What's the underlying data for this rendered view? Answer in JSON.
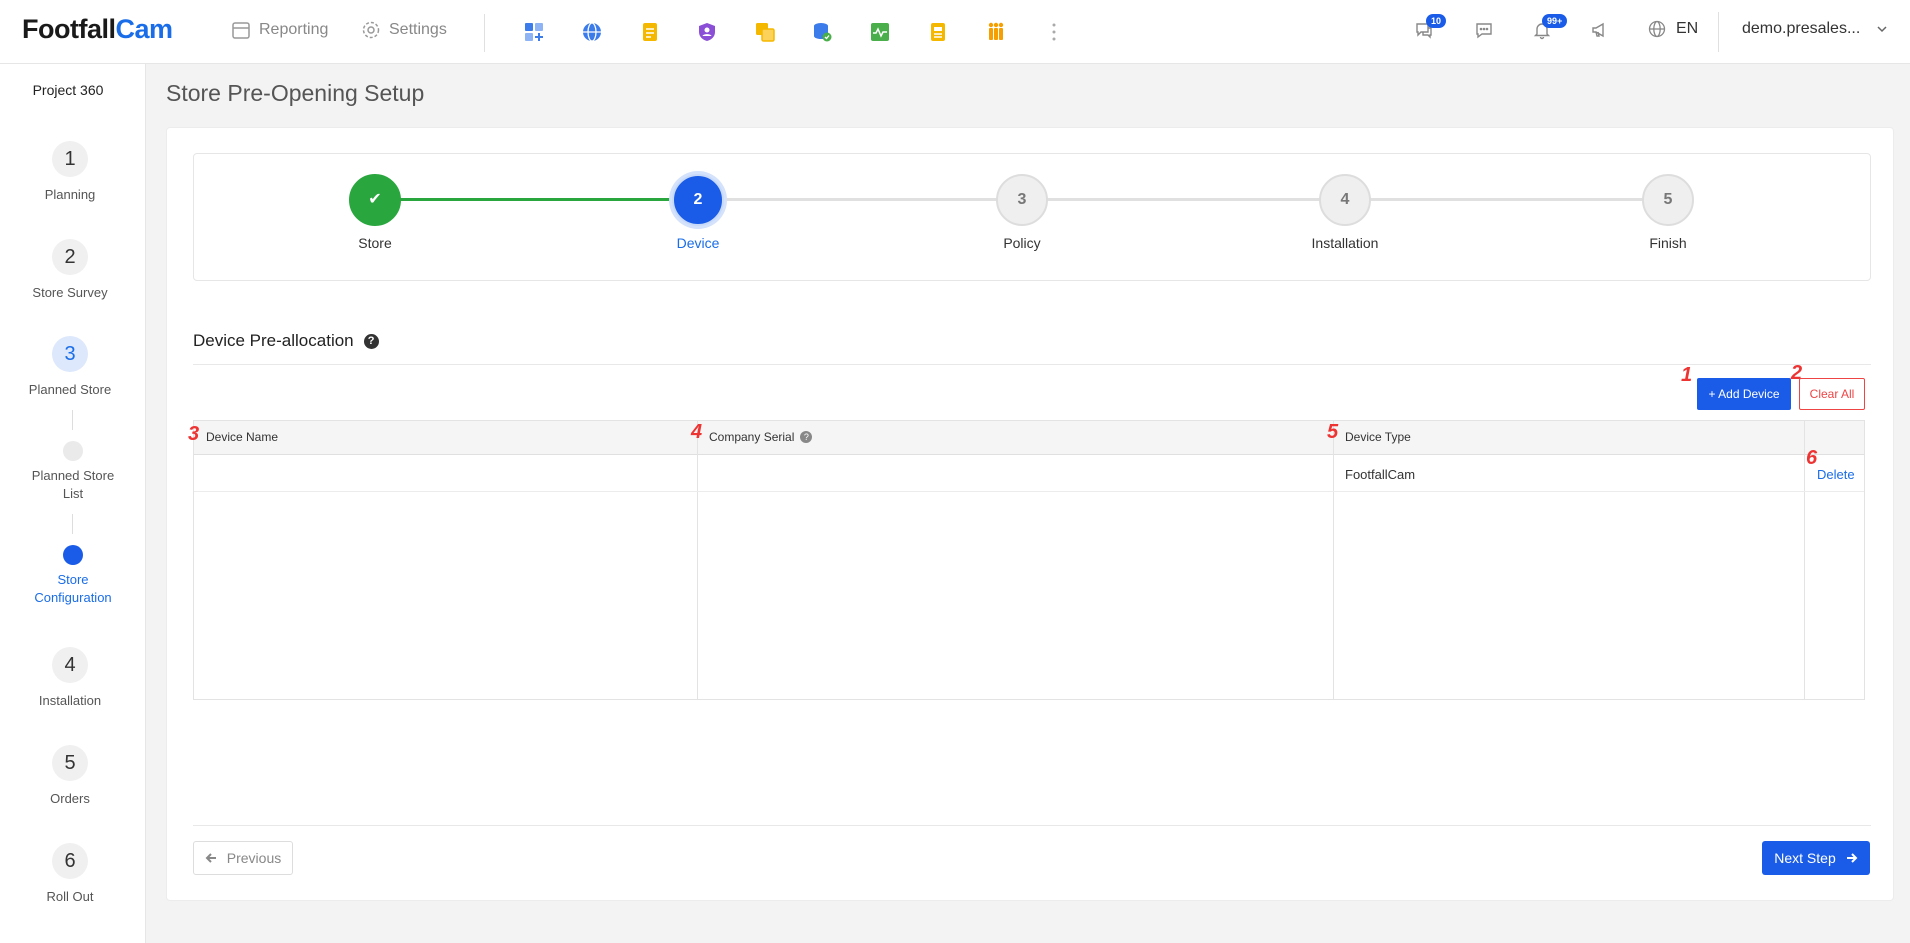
{
  "header": {
    "logo_part1": "Footfall",
    "logo_part2": "Cam",
    "nav": [
      {
        "label": "Reporting",
        "icon": "calendar-icon"
      },
      {
        "label": "Settings",
        "icon": "gear-icon"
      }
    ],
    "apps": [
      {
        "icon": "dashboard-add-icon",
        "color": "#3b7bea"
      },
      {
        "icon": "globe-icon",
        "color": "#3b7bea"
      },
      {
        "icon": "notepad-icon",
        "color": "#f5b800"
      },
      {
        "icon": "shield-user-icon",
        "color": "#8a4fd6"
      },
      {
        "icon": "layers-icon",
        "color": "#f5b800"
      },
      {
        "icon": "database-check-icon",
        "color": "#3b7bea"
      },
      {
        "icon": "activity-chart-icon",
        "color": "#4aae4a"
      },
      {
        "icon": "document-icon",
        "color": "#f5b800"
      },
      {
        "icon": "people-icon",
        "color": "#f5a000"
      }
    ],
    "chat_badge": "10",
    "notification_badge": "99+",
    "language": "EN",
    "user": "demo.presales..."
  },
  "sidebar": {
    "title": "Project 360",
    "steps": [
      {
        "number": "1",
        "label": "Planning"
      },
      {
        "number": "2",
        "label": "Store Survey"
      },
      {
        "number": "3",
        "label": "Planned Store"
      },
      {
        "number": "4",
        "label": "Installation"
      },
      {
        "number": "5",
        "label": "Orders"
      },
      {
        "number": "6",
        "label": "Roll Out"
      }
    ],
    "substeps": [
      {
        "label": "Planned Store List"
      },
      {
        "label": "Store Configuration"
      }
    ]
  },
  "main": {
    "title": "Store Pre-Opening Setup",
    "stepper": [
      {
        "number": "✔",
        "label": "Store",
        "state": "done"
      },
      {
        "number": "2",
        "label": "Device",
        "state": "current"
      },
      {
        "number": "3",
        "label": "Policy",
        "state": "pending"
      },
      {
        "number": "4",
        "label": "Installation",
        "state": "pending"
      },
      {
        "number": "5",
        "label": "Finish",
        "state": "pending"
      }
    ],
    "section_title": "Device Pre-allocation",
    "add_device_label": "+ Add Device",
    "clear_all_label": "Clear All",
    "table": {
      "columns": [
        "Device Name",
        "Company Serial",
        "Device Type"
      ],
      "rows": [
        {
          "device_name": "",
          "company_serial": "",
          "device_type": "FootfallCam",
          "action": "Delete"
        }
      ]
    },
    "markers": [
      "1",
      "2",
      "3",
      "4",
      "5",
      "6"
    ],
    "previous_label": "Previous",
    "next_label": "Next Step"
  }
}
